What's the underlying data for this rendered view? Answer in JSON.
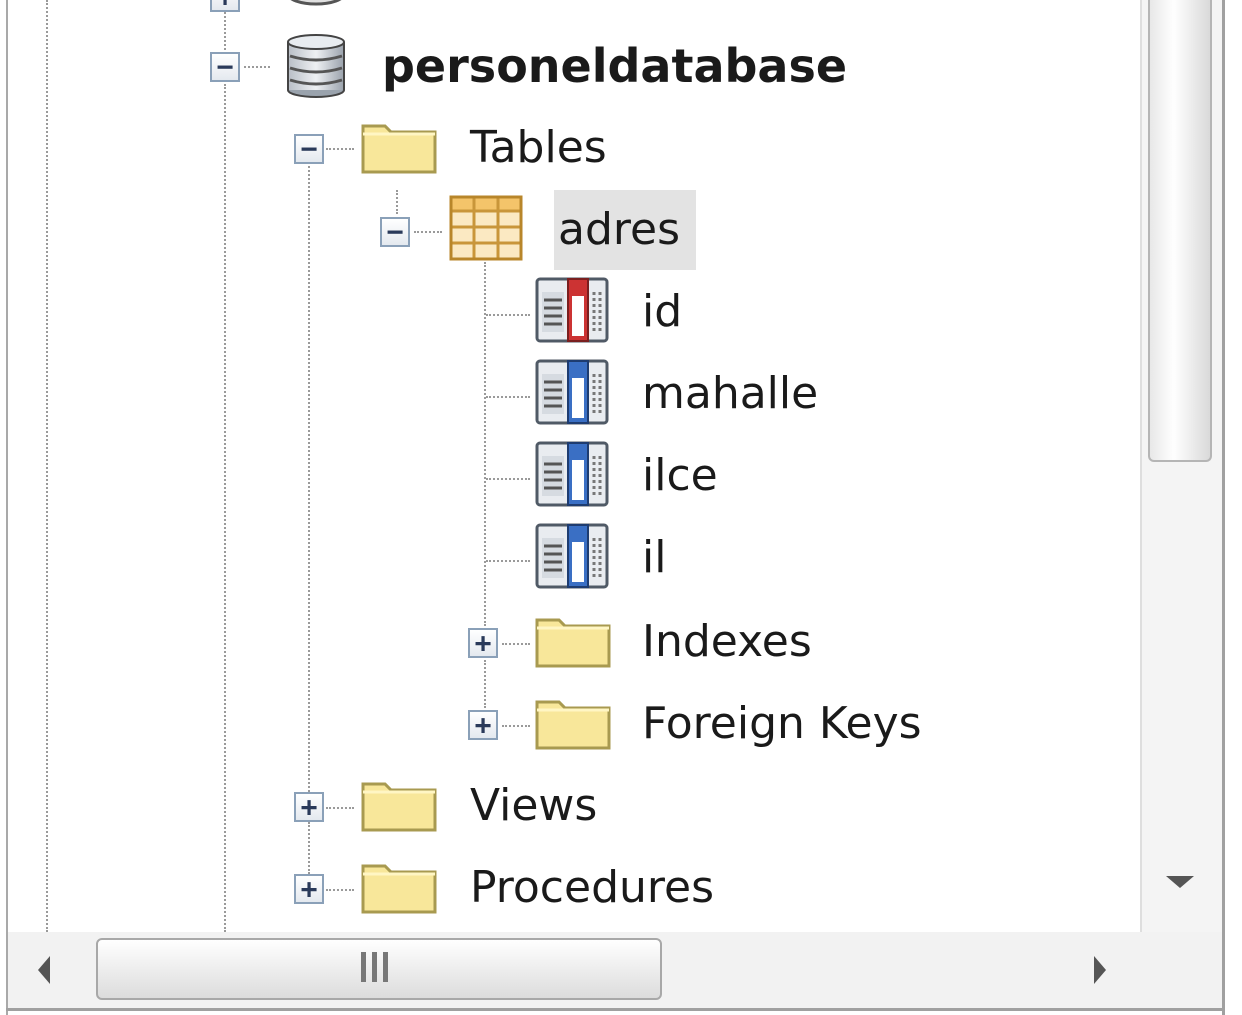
{
  "tree": {
    "database": {
      "label": "personeldatabase",
      "expanded": true,
      "icon": "database-icon"
    },
    "tables_folder": {
      "label": "Tables",
      "expanded": true,
      "icon": "folder-icon"
    },
    "table": {
      "label": "adres",
      "expanded": true,
      "selected": true,
      "icon": "table-grid-icon"
    },
    "columns": [
      {
        "label": "id",
        "icon": "primary-key-column-icon"
      },
      {
        "label": "mahalle",
        "icon": "column-icon"
      },
      {
        "label": "ilce",
        "icon": "column-icon"
      },
      {
        "label": "il",
        "icon": "column-icon"
      }
    ],
    "table_children": [
      {
        "label": "Indexes",
        "expanded": false,
        "icon": "folder-icon"
      },
      {
        "label": "Foreign Keys",
        "expanded": false,
        "icon": "folder-icon"
      }
    ],
    "db_children": [
      {
        "label": "Views",
        "expanded": false,
        "icon": "folder-icon"
      },
      {
        "label": "Procedures",
        "expanded": false,
        "icon": "folder-icon"
      }
    ],
    "toggle_expanded": "−",
    "toggle_collapsed": "+"
  },
  "colors": {
    "folder": "#f8e79a",
    "folder_border": "#a89a50",
    "selection": "#e3e3e3",
    "pk_accent": "#cc3333",
    "column_accent": "#3a6fc4"
  },
  "scrollbars": {
    "vertical_position": 0.0,
    "horizontal_position": 0.0
  }
}
